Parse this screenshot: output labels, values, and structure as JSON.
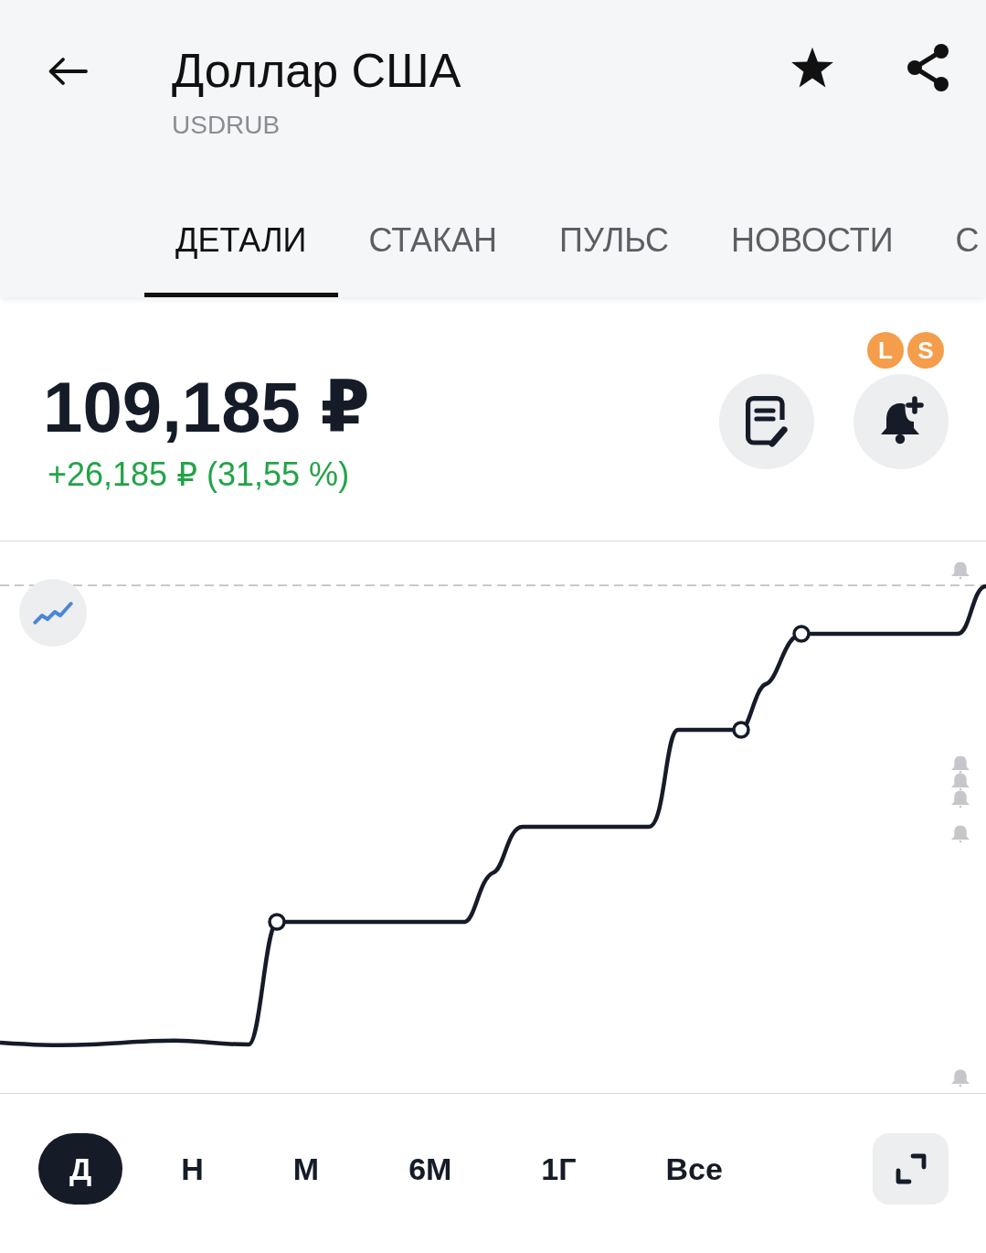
{
  "header": {
    "title": "Доллар США",
    "ticker": "USDRUB",
    "favorite": true
  },
  "tabs": [
    {
      "label": "ДЕТАЛИ",
      "selected": true
    },
    {
      "label": "СТАКАН",
      "selected": false
    },
    {
      "label": "ПУЛЬС",
      "selected": false
    },
    {
      "label": "НОВОСТИ",
      "selected": false
    },
    {
      "label": "С",
      "selected": false
    }
  ],
  "quote": {
    "price": "109,185 ₽",
    "change": "+26,185 ₽ (31,55 %)",
    "badges": [
      {
        "label": "L"
      },
      {
        "label": "S"
      }
    ]
  },
  "periods": [
    {
      "label": "Д",
      "selected": true
    },
    {
      "label": "Н",
      "selected": false
    },
    {
      "label": "М",
      "selected": false
    },
    {
      "label": "6М",
      "selected": false
    },
    {
      "label": "1Г",
      "selected": false
    },
    {
      "label": "Все",
      "selected": false
    }
  ]
}
